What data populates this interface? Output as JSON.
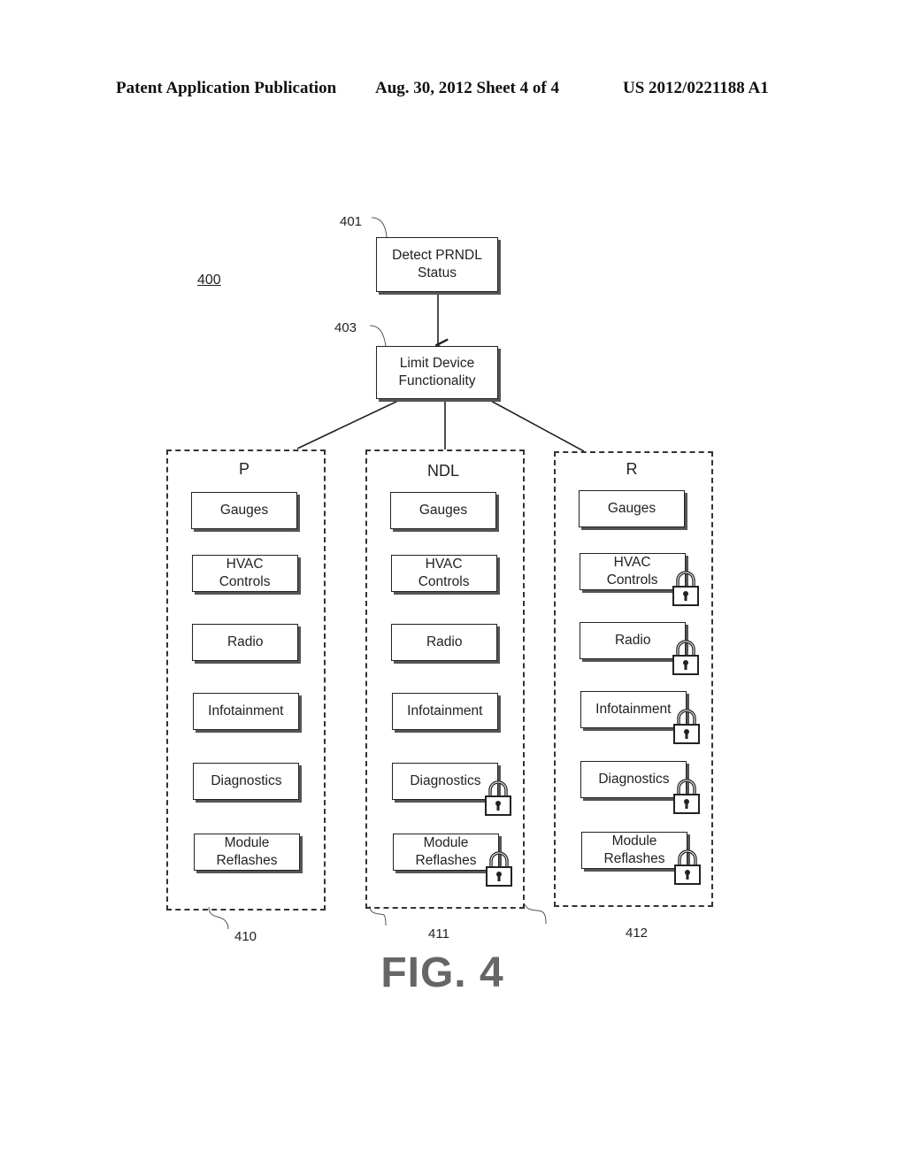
{
  "header": {
    "left": "Patent Application Publication",
    "center": "Aug. 30, 2012  Sheet 4 of 4",
    "right": "US 2012/0221188 A1"
  },
  "diagram": {
    "figure_ref": "400",
    "steps": [
      {
        "ref": "401",
        "label_line1": "Detect PRNDL",
        "label_line2": "Status"
      },
      {
        "ref": "403",
        "label_line1": "Limit Device",
        "label_line2": "Functionality"
      }
    ],
    "groups": [
      {
        "ref": "410",
        "title": "P",
        "items": [
          {
            "l1": "Gauges",
            "l2": "",
            "locked": false
          },
          {
            "l1": "HVAC",
            "l2": "Controls",
            "locked": false
          },
          {
            "l1": "Radio",
            "l2": "",
            "locked": false
          },
          {
            "l1": "Infotainment",
            "l2": "",
            "locked": false
          },
          {
            "l1": "Diagnostics",
            "l2": "",
            "locked": false
          },
          {
            "l1": "Module",
            "l2": "Reflashes",
            "locked": false
          }
        ]
      },
      {
        "ref": "411",
        "title": "NDL",
        "items": [
          {
            "l1": "Gauges",
            "l2": "",
            "locked": false
          },
          {
            "l1": "HVAC",
            "l2": "Controls",
            "locked": false
          },
          {
            "l1": "Radio",
            "l2": "",
            "locked": false
          },
          {
            "l1": "Infotainment",
            "l2": "",
            "locked": false
          },
          {
            "l1": "Diagnostics",
            "l2": "",
            "locked": true
          },
          {
            "l1": "Module",
            "l2": "Reflashes",
            "locked": true
          }
        ]
      },
      {
        "ref": "412",
        "title": "R",
        "items": [
          {
            "l1": "Gauges",
            "l2": "",
            "locked": false
          },
          {
            "l1": "HVAC",
            "l2": "Controls",
            "locked": true
          },
          {
            "l1": "Radio",
            "l2": "",
            "locked": true
          },
          {
            "l1": "Infotainment",
            "l2": "",
            "locked": true
          },
          {
            "l1": "Diagnostics",
            "l2": "",
            "locked": true
          },
          {
            "l1": "Module",
            "l2": "Reflashes",
            "locked": true
          }
        ]
      }
    ],
    "caption": "FIG. 4"
  }
}
